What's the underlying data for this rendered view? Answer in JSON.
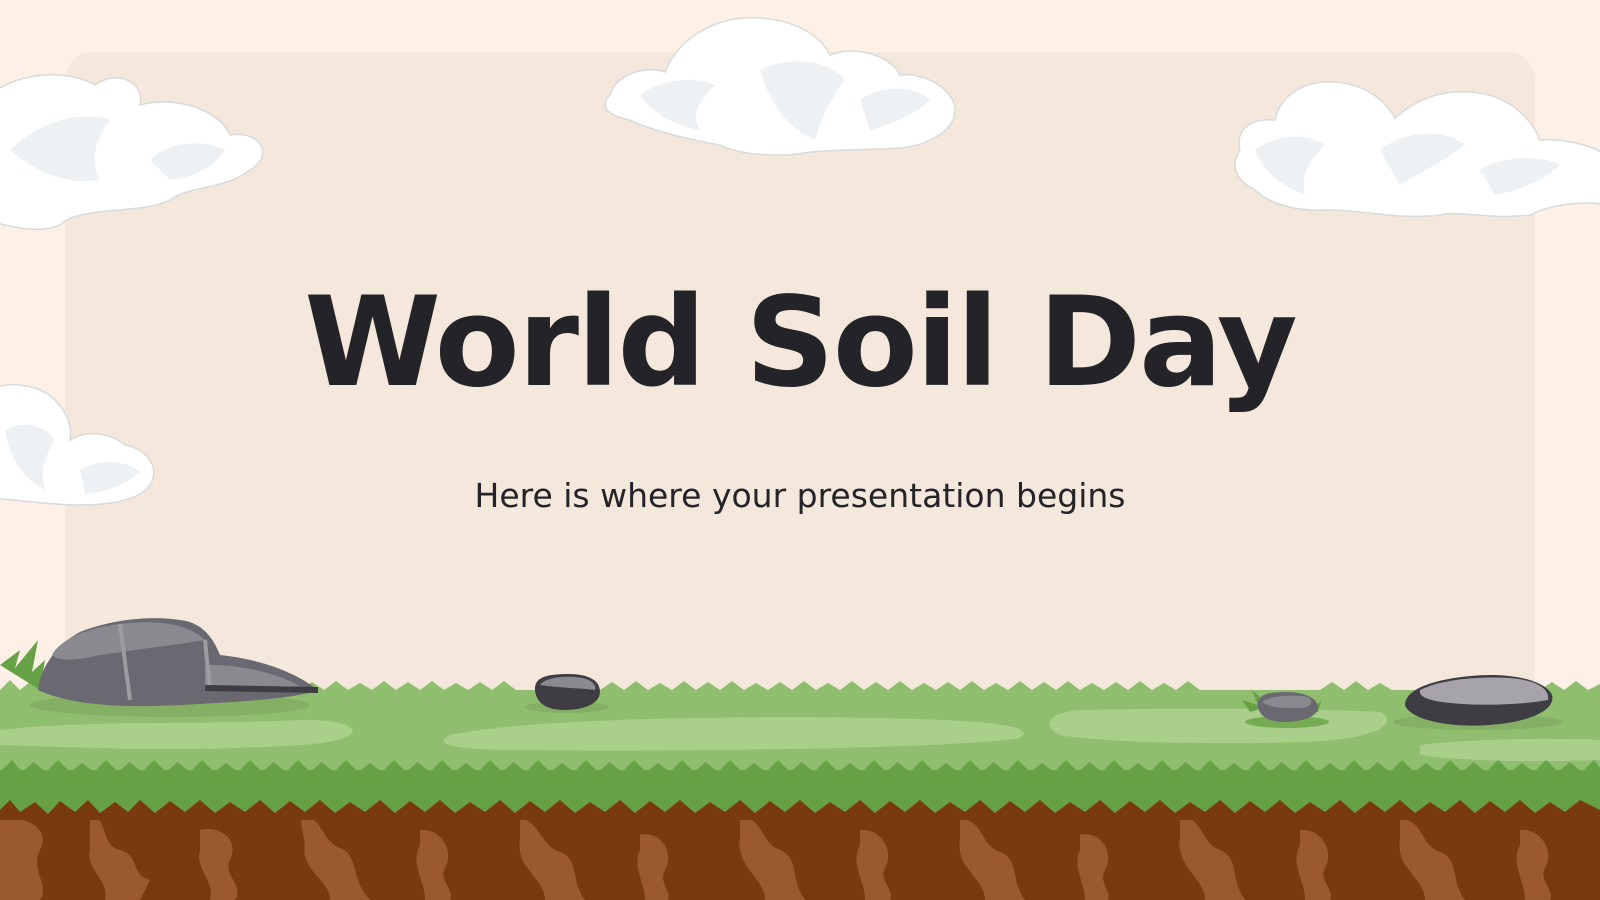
{
  "slide": {
    "title": "World Soil Day",
    "subtitle": "Here is where your presentation begins"
  },
  "colors": {
    "background": "#fdf0e6",
    "panel": "#f4e8dd",
    "text": "#242328",
    "grass": "#8fbf6e",
    "grass_dark": "#67a145",
    "soil": "#7a3a10",
    "soil_light": "#9b5a2e",
    "rock": "#6a6870",
    "cloud": "#ffffff"
  },
  "icons": [
    "cloud-icon",
    "rock-icon",
    "grass-tuft-icon",
    "soil-layer-icon"
  ]
}
